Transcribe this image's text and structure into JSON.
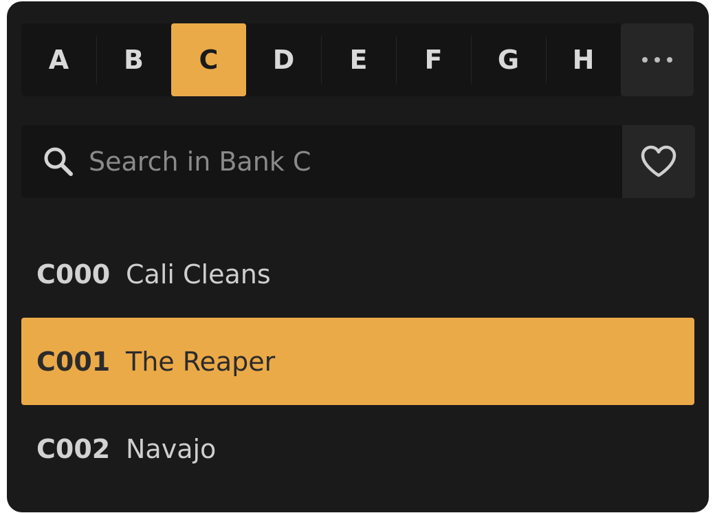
{
  "bank_tabs": [
    {
      "label": "A",
      "active": false
    },
    {
      "label": "B",
      "active": false
    },
    {
      "label": "C",
      "active": true
    },
    {
      "label": "D",
      "active": false
    },
    {
      "label": "E",
      "active": false
    },
    {
      "label": "F",
      "active": false
    },
    {
      "label": "G",
      "active": false
    },
    {
      "label": "H",
      "active": false
    }
  ],
  "more_button_icon": "more-dots-icon",
  "search": {
    "placeholder": "Search in Bank C",
    "value": "",
    "icon": "search-icon"
  },
  "favorites_icon": "heart-icon",
  "presets": [
    {
      "code": "C000",
      "name": "Cali Cleans",
      "selected": false
    },
    {
      "code": "C001",
      "name": "The Reaper",
      "selected": true
    },
    {
      "code": "C002",
      "name": "Navajo",
      "selected": false
    }
  ],
  "colors": {
    "accent": "#ebaa48",
    "panel": "#1a1a1a",
    "control": "#141414",
    "button": "#262626"
  }
}
